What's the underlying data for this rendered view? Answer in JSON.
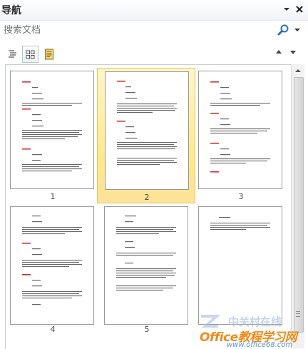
{
  "panel": {
    "title": "导航",
    "dropdown_icon": "chevron-down-icon",
    "close_icon": "close-icon"
  },
  "search": {
    "placeholder": "搜索文档",
    "value": "",
    "icon": "magnifier-icon",
    "dropdown_icon": "chevron-down-icon"
  },
  "view_tabs": [
    {
      "name": "headings",
      "icon": "outline-list-icon",
      "active": false
    },
    {
      "name": "pages",
      "icon": "thumbnail-grid-icon",
      "active": true
    },
    {
      "name": "results",
      "icon": "document-page-icon",
      "active": false
    }
  ],
  "nav_arrows": {
    "previous": "triangle-up-icon",
    "next": "triangle-down-icon"
  },
  "pages": [
    {
      "label": "1",
      "selected": false
    },
    {
      "label": "2",
      "selected": true
    },
    {
      "label": "3",
      "selected": false
    },
    {
      "label": "4",
      "selected": false
    },
    {
      "label": "5",
      "selected": false
    },
    {
      "label": "",
      "selected": false
    }
  ],
  "watermark": {
    "cn_text": "中关村在线",
    "brand": "Office教程学习网",
    "url": "www.office68.com"
  },
  "colors": {
    "selection_fill": "#ffe88a",
    "heading_red": "#d8322a",
    "body_text": "#5a5a5a",
    "watermark_orange": "#f08a19",
    "watermark_blue": "#5a8fd6"
  }
}
